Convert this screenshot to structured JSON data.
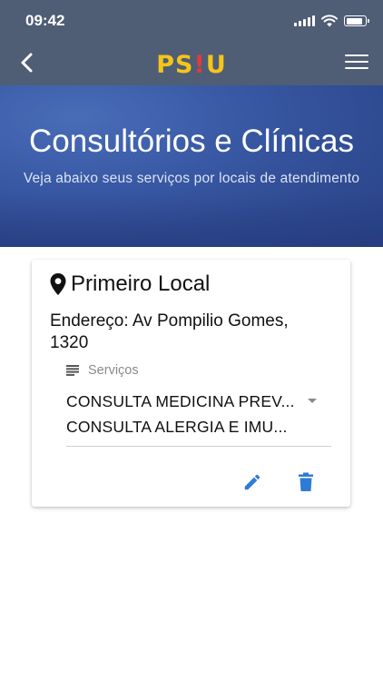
{
  "status_bar": {
    "time": "09:42",
    "battery_level": 0.85,
    "icons": [
      "signal-icon",
      "wifi-icon",
      "battery-icon"
    ]
  },
  "nav": {
    "back_icon": "chevron-left-icon",
    "logo_part1": "PS",
    "logo_bang": "!",
    "logo_part2": "U",
    "menu_icon": "hamburger-menu-icon"
  },
  "header": {
    "title": "Consultórios e Clínicas",
    "subtitle": "Veja abaixo seus serviços por locais de atendimento"
  },
  "location_card": {
    "pin_icon": "location-pin-icon",
    "name": "Primeiro Local",
    "address": "Endereço: Av Pompilio Gomes, 1320",
    "services_label": "Serviços",
    "services_icon": "list-icon",
    "services": [
      "CONSULTA MEDICINA PREV...",
      "CONSULTA ALERGIA E IMU..."
    ],
    "edit_icon": "pencil-icon",
    "delete_icon": "trash-icon"
  },
  "colors": {
    "topbar": "#4f5d75",
    "banner": "#3a5aa6",
    "logo_yellow": "#f5c518",
    "logo_red": "#e23b3b",
    "action_blue": "#2e7bd6"
  }
}
